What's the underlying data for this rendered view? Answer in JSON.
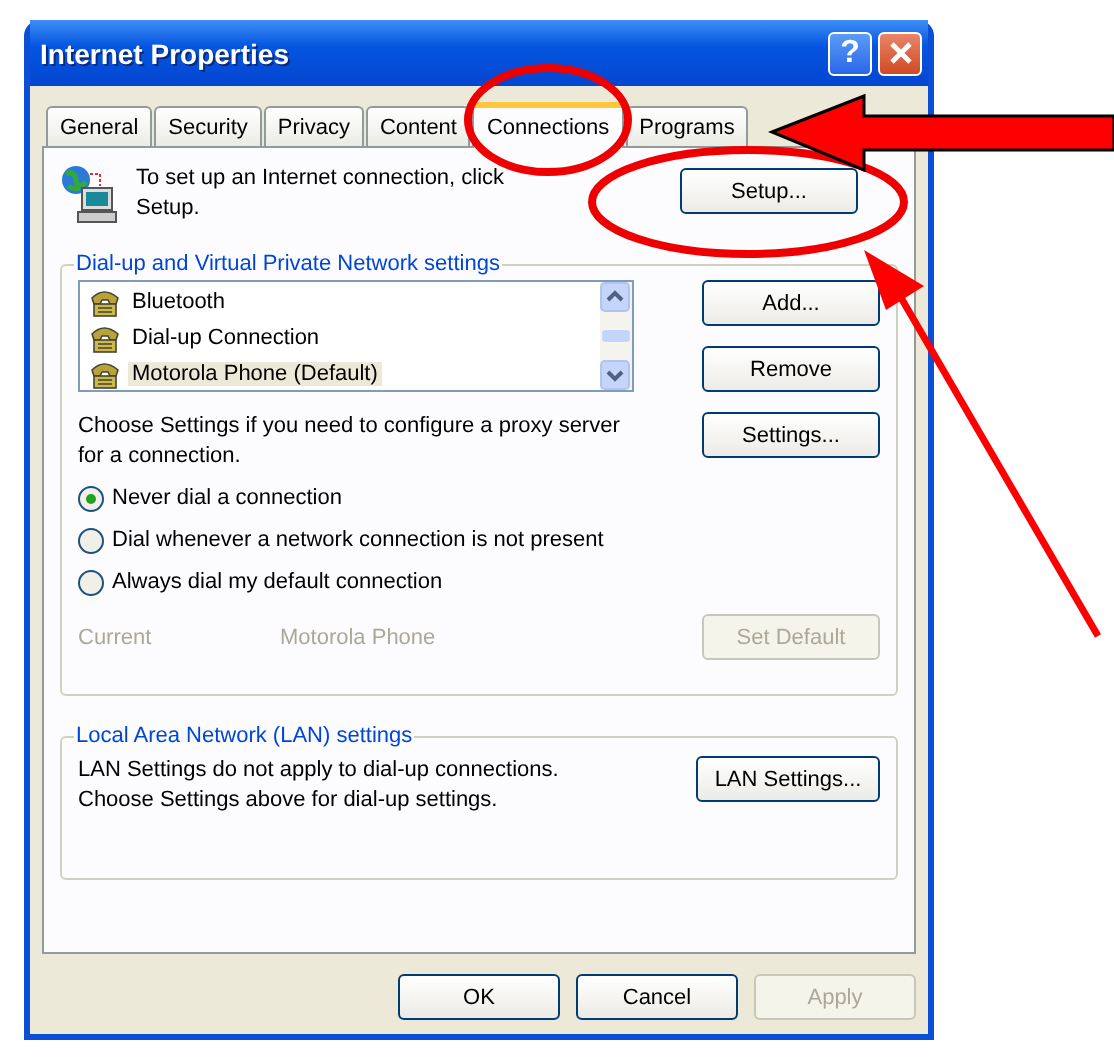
{
  "window": {
    "title": "Internet Properties",
    "help": "?"
  },
  "tabs": [
    {
      "label": "General",
      "selected": false
    },
    {
      "label": "Security",
      "selected": false
    },
    {
      "label": "Privacy",
      "selected": false
    },
    {
      "label": "Content",
      "selected": false
    },
    {
      "label": "Connections",
      "selected": true
    },
    {
      "label": "Programs",
      "selected": false
    }
  ],
  "intro": {
    "text": "To set up an Internet connection, click Setup.",
    "button": "Setup..."
  },
  "dialup": {
    "title": "Dial-up and Virtual Private Network settings",
    "connections": [
      {
        "name": "Bluetooth",
        "selected": false
      },
      {
        "name": "Dial-up Connection",
        "selected": false
      },
      {
        "name": "Motorola Phone (Default)",
        "selected": true
      }
    ],
    "buttons": [
      {
        "label": "Add...",
        "disabled": false
      },
      {
        "label": "Remove",
        "disabled": false
      }
    ],
    "proxy_text": "Choose Settings if you need to configure a proxy server for a connection.",
    "settings_button": "Settings...",
    "options": [
      {
        "label": "Never dial a connection",
        "selected": true
      },
      {
        "label": "Dial whenever a network connection is not present",
        "selected": false
      },
      {
        "label": "Always dial my default connection",
        "selected": false
      }
    ],
    "current_label": "Current",
    "current_value": "Motorola Phone",
    "current_disabled": true,
    "set_default": {
      "label": "Set Default",
      "disabled": true
    }
  },
  "lan": {
    "title": "Local Area Network (LAN) settings",
    "text": "LAN Settings do not apply to dial-up connections. Choose Settings above for dial-up settings.",
    "button": "LAN Settings..."
  },
  "buttons": [
    {
      "label": "OK",
      "disabled": false
    },
    {
      "label": "Cancel",
      "disabled": false
    },
    {
      "label": "Apply",
      "disabled": true
    }
  ]
}
